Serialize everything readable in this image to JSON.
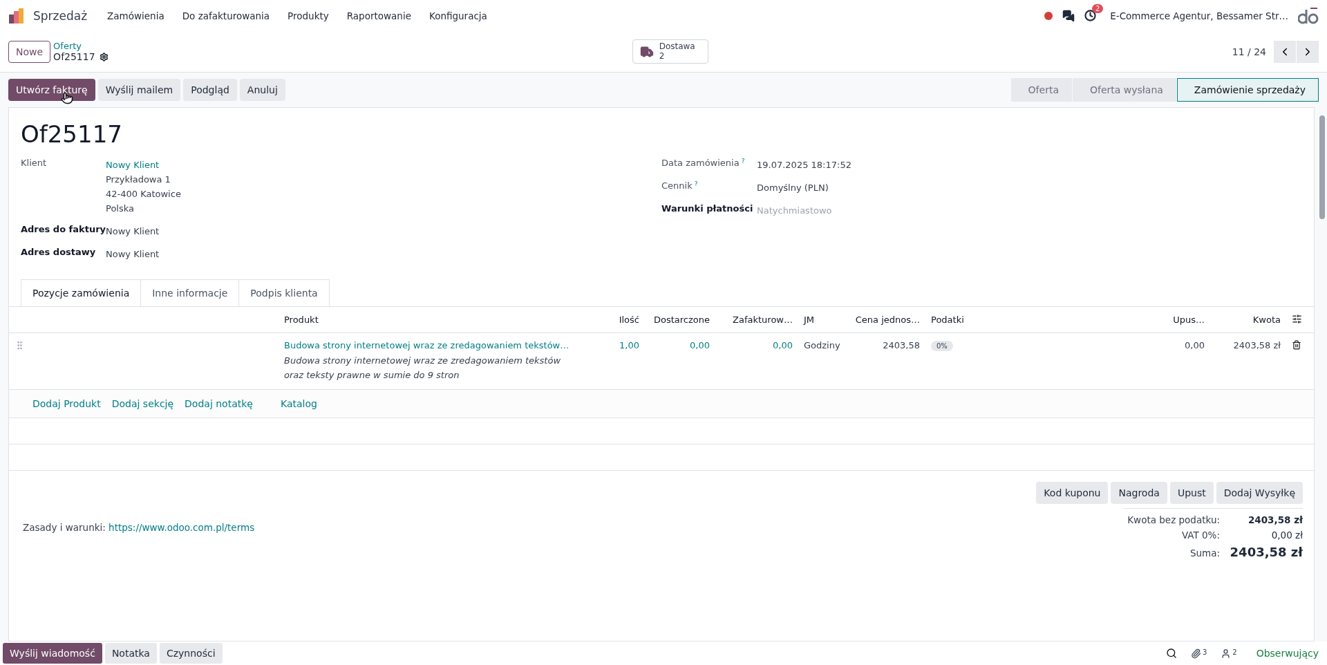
{
  "navbar": {
    "app": "Sprzedaż",
    "menu": [
      "Zamówienia",
      "Do zafakturowania",
      "Produkty",
      "Raportowanie",
      "Konfiguracja"
    ],
    "activity_count": "2",
    "company": "E-Commerce Agentur, Bessamer Str…"
  },
  "control_panel": {
    "new_button": "Nowe",
    "breadcrumb": "Oferty",
    "record": "Of25117",
    "smart_button": {
      "label": "Dostawa",
      "count": "2"
    },
    "pager": "11 / 24"
  },
  "actions": [
    {
      "label": "Utwórz fakturę",
      "primary": true
    },
    {
      "label": "Wyślij mailem",
      "primary": false
    },
    {
      "label": "Podgląd",
      "primary": false
    },
    {
      "label": "Anuluj",
      "primary": false
    }
  ],
  "status_steps": [
    {
      "label": "Oferta",
      "selected": false
    },
    {
      "label": "Oferta wysłana",
      "selected": false
    },
    {
      "label": "Zamówienie sprzedaży",
      "selected": true
    }
  ],
  "title": "Of25117",
  "left_fields": [
    {
      "label": "Klient",
      "strong": false,
      "value": "Nowy Klient",
      "link": true,
      "lines": [
        "Przykładowa 1",
        "42-400 Katowice",
        "Polska"
      ]
    },
    {
      "label": "Adres do faktury",
      "strong": true,
      "value": "Nowy Klient",
      "link": false
    },
    {
      "label": "Adres dostawy",
      "strong": true,
      "value": "Nowy Klient",
      "link": false
    }
  ],
  "right_fields": [
    {
      "label": "Data zamówienia",
      "help": "?",
      "strong": false,
      "value": "19.07.2025 18:17:52"
    },
    {
      "label": "Cennik",
      "help": "?",
      "strong": false,
      "value": "Domyślny (PLN)"
    },
    {
      "label": "Warunki płatności",
      "strong": true,
      "placeholder": "Natychmiastowo"
    }
  ],
  "tabs": [
    {
      "label": "Pozycje zamówienia",
      "selected": true
    },
    {
      "label": "Inne informacje",
      "selected": false
    },
    {
      "label": "Podpis klienta",
      "selected": false
    }
  ],
  "table": {
    "columns": [
      "Produkt",
      "Ilość",
      "Dostarczone",
      "Zafakturow…",
      "JM",
      "Cena jednos…",
      "Podatki",
      "Upus…",
      "Kwota"
    ],
    "rows": [
      {
        "product": "Budowa strony internetowej wraz ze zredagowaniem tekstów…",
        "description": [
          "Budowa strony internetowej wraz ze zredagowaniem tekstów",
          "oraz teksty prawne w sumie do 9 stron"
        ],
        "quantity": "1,00",
        "delivered": "0,00",
        "invoiced": "0,00",
        "uom": "Godziny",
        "price": "2403,58",
        "tax": "0%",
        "discount": "0,00",
        "amount": "2403,58 zł"
      }
    ],
    "add_links": [
      "Dodaj Produkt",
      "Dodaj sekcję",
      "Dodaj notatkę",
      "Katalog"
    ]
  },
  "extra_buttons": [
    "Kod kuponu",
    "Nagroda",
    "Upust",
    "Dodaj Wysyłkę"
  ],
  "terms": {
    "label": "Zasady i warunki:",
    "link": "https://www.odoo.com.pl/terms"
  },
  "totals": [
    {
      "label": "Kwota bez podatku:",
      "value": "2403,58 zł",
      "kind": "bold"
    },
    {
      "label": "VAT 0%:",
      "value": "0,00 zł",
      "kind": "plain"
    },
    {
      "label": "Suma:",
      "value": "2403,58 zł",
      "kind": "grand"
    }
  ],
  "chatter": {
    "buttons": [
      {
        "label": "Wyślij wiadomość",
        "selected": true
      },
      {
        "label": "Notatka",
        "selected": false
      },
      {
        "label": "Czynności",
        "selected": false
      }
    ],
    "attachments": "3",
    "followers": "2",
    "follow": "Obserwujący"
  }
}
